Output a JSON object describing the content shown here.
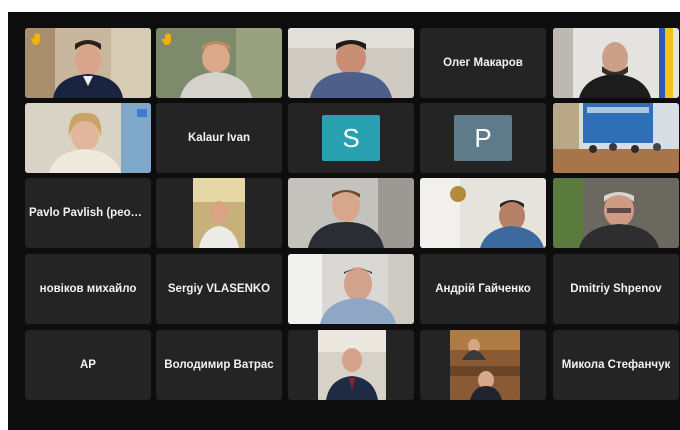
{
  "meeting": {
    "participants": [
      {
        "name": "",
        "hand_raised": true
      },
      {
        "name": "",
        "hand_raised": true
      },
      {
        "name": ""
      },
      {
        "name": "Олег Макаров"
      },
      {
        "name": ""
      },
      {
        "name": ""
      },
      {
        "name": "Kalaur Ivan"
      },
      {
        "name": "",
        "initial": "S"
      },
      {
        "name": "",
        "initial": "P"
      },
      {
        "name": ""
      },
      {
        "name": "Pavlo Pavlish (реод..."
      },
      {
        "name": ""
      },
      {
        "name": ""
      },
      {
        "name": ""
      },
      {
        "name": "",
        "active_speaker": true
      },
      {
        "name": "новіков михайло"
      },
      {
        "name": "Sergiy VLASENKO"
      },
      {
        "name": ""
      },
      {
        "name": "Андрій Гайченко"
      },
      {
        "name": "Dmitriy Shpenov"
      },
      {
        "name": "AP"
      },
      {
        "name": "Володимир Ватрас"
      },
      {
        "name": ""
      },
      {
        "name": ""
      },
      {
        "name": "Микола Стефанчук"
      }
    ]
  },
  "colors": {
    "avatar_s": "#2aa1b0",
    "avatar_p": "#5e7b8a",
    "active_speaker_border": "#3fbf4f",
    "hand_raised": "#f2b300"
  },
  "icons": [
    "raised-hand-icon"
  ]
}
